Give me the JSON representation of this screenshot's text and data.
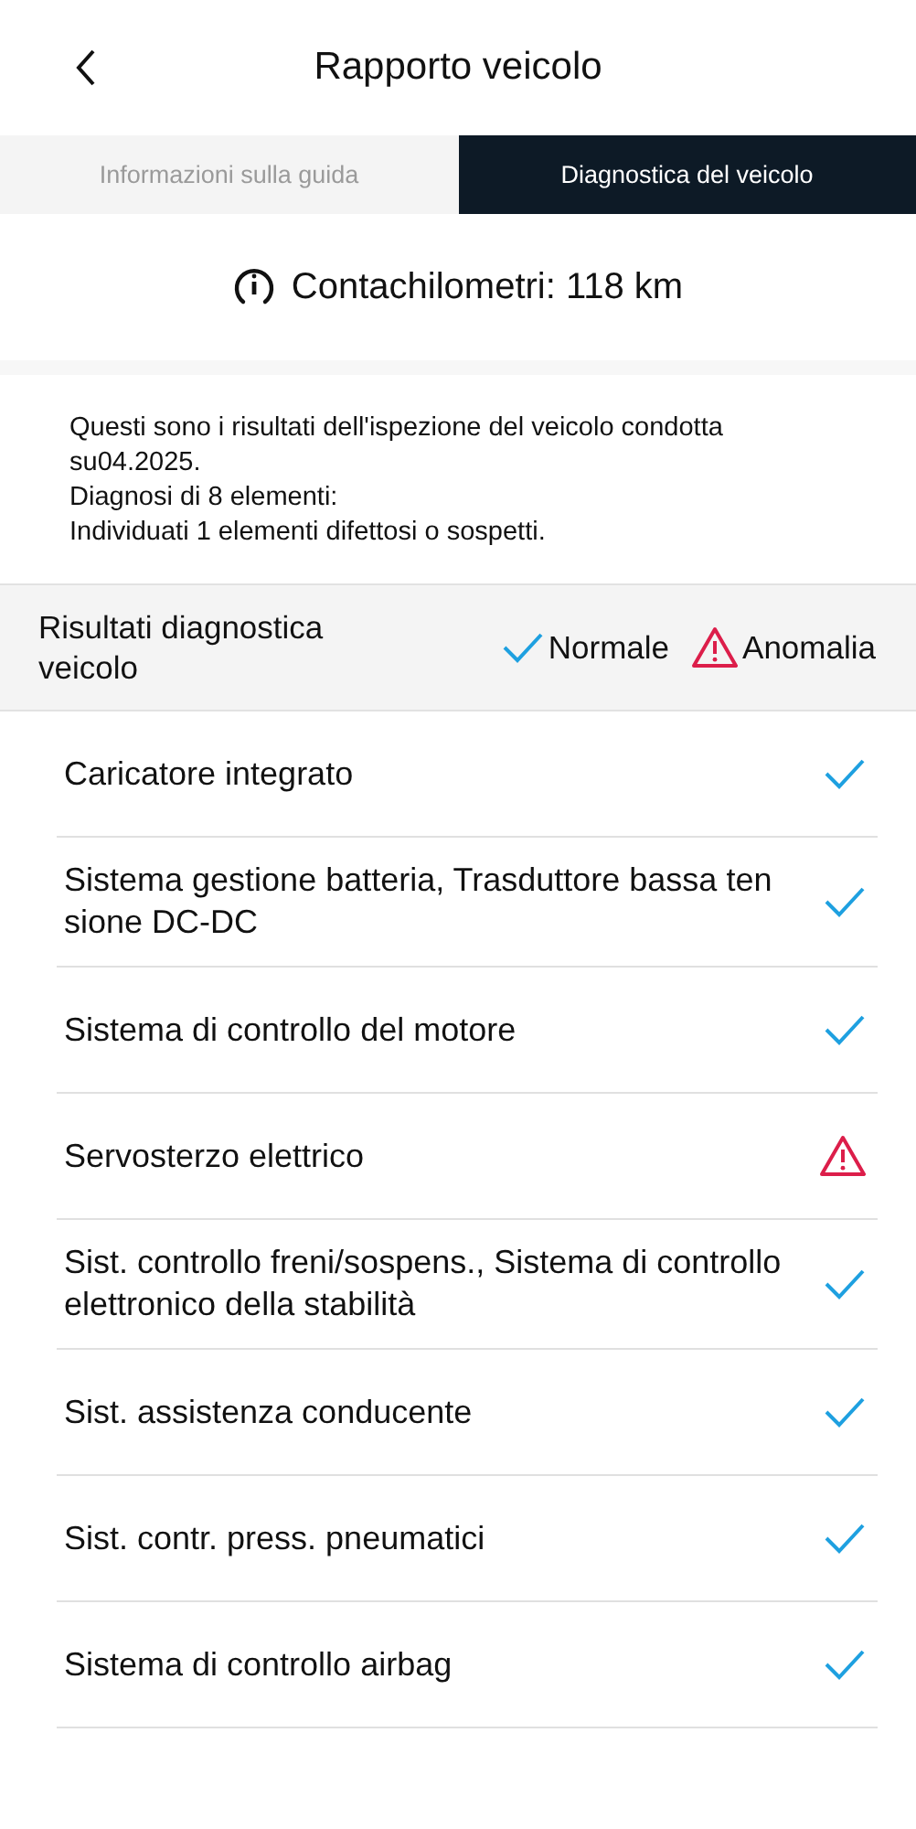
{
  "header": {
    "title": "Rapporto veicolo"
  },
  "tabs": [
    {
      "label": "Informazioni sulla guida",
      "selected": false
    },
    {
      "label": "Diagnostica del veicolo",
      "selected": true
    }
  ],
  "odometer": {
    "label": "Contachilometri: 118 km"
  },
  "summary": [
    "Questi sono i risultati dell'ispezione del veicolo condotta su04.2025.",
    "Diagnosi di 8 elementi:",
    "Individuati 1 elementi difettosi o sospetti."
  ],
  "legend": {
    "title": "Risultati diagnostica veicolo",
    "items": [
      {
        "kind": "normal",
        "label": "Normale"
      },
      {
        "kind": "anomaly",
        "label": "Anomalia"
      }
    ]
  },
  "results": [
    {
      "name": "Caricatore integrato",
      "kind": "normal"
    },
    {
      "name": "Sistema gestione batteria, Trasduttore bassa tensione DC-DC",
      "kind": "normal"
    },
    {
      "name": "Sistema di controllo del motore",
      "kind": "normal"
    },
    {
      "name": "Servosterzo elettrico",
      "kind": "anomaly"
    },
    {
      "name": "Sist. controllo freni/sospens., Sistema di controllo elettronico della stabilità",
      "kind": "normal"
    },
    {
      "name": "Sist. assistenza conducente",
      "kind": "normal"
    },
    {
      "name": "Sist. contr. press. pneumatici",
      "kind": "normal"
    },
    {
      "name": "Sistema di controllo airbag",
      "kind": "normal"
    }
  ]
}
